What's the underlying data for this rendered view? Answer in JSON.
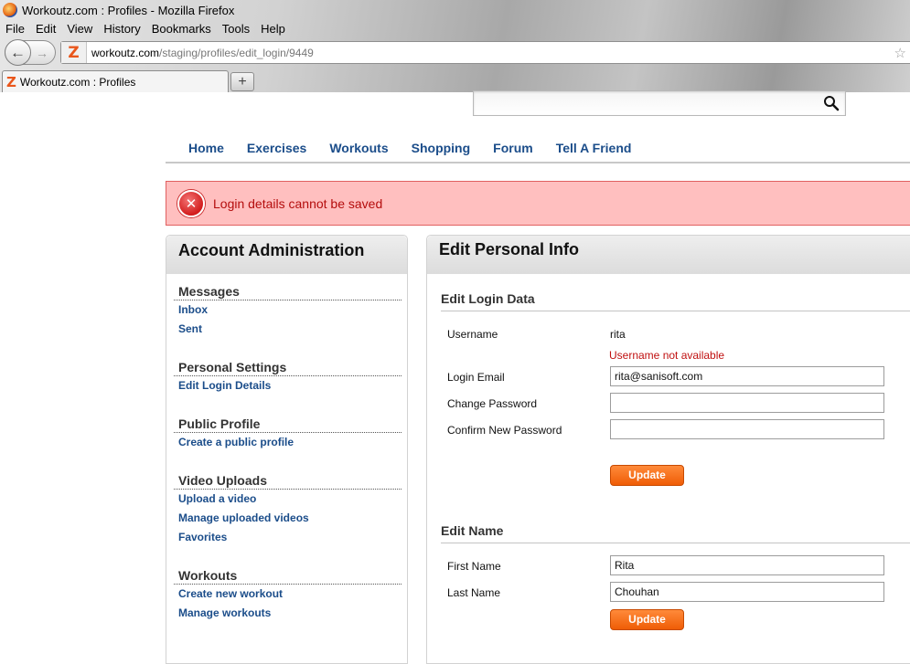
{
  "browser": {
    "window_title": "Workoutz.com : Profiles - Mozilla Firefox",
    "menu": [
      "File",
      "Edit",
      "View",
      "History",
      "Bookmarks",
      "Tools",
      "Help"
    ],
    "url_domain": "workoutz.com",
    "url_path": "/staging/profiles/edit_login/9449",
    "tab_title": "Workoutz.com : Profiles",
    "newtab_label": "+"
  },
  "nav": {
    "items": [
      "Home",
      "Exercises",
      "Workouts",
      "Shopping",
      "Forum",
      "Tell A Friend"
    ]
  },
  "error": {
    "message": "Login details cannot be saved",
    "icon_glyph": "✕"
  },
  "sidebar": {
    "title": "Account Administration",
    "sections": [
      {
        "title": "Messages",
        "links": [
          "Inbox",
          "Sent"
        ]
      },
      {
        "title": "Personal Settings",
        "links": [
          "Edit Login Details"
        ]
      },
      {
        "title": "Public Profile",
        "links": [
          "Create a public profile"
        ]
      },
      {
        "title": "Video Uploads",
        "links": [
          "Upload a video",
          "Manage uploaded videos",
          "Favorites"
        ]
      },
      {
        "title": "Workouts",
        "links": [
          "Create new workout",
          "Manage workouts"
        ]
      }
    ]
  },
  "main": {
    "title": "Edit Personal Info",
    "login": {
      "heading": "Edit Login Data",
      "username_label": "Username",
      "username_value": "rita",
      "username_error": "Username not available",
      "email_label": "Login Email",
      "email_value": "rita@sanisoft.com",
      "password_label": "Change Password",
      "password_value": "",
      "confirm_label": "Confirm New Password",
      "confirm_value": "",
      "update_label": "Update"
    },
    "name": {
      "heading": "Edit Name",
      "first_label": "First Name",
      "first_value": "Rita",
      "last_label": "Last Name",
      "last_value": "Chouhan",
      "update_label": "Update"
    }
  },
  "colors": {
    "link_blue": "#1b4d8a",
    "error_bg": "#ffbfbf",
    "error_text": "#b40d0d",
    "button_orange": "#ef5d06"
  }
}
